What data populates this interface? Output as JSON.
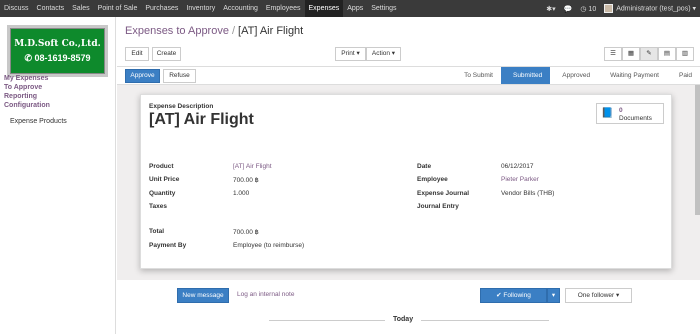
{
  "topbar": {
    "menu": [
      "Discuss",
      "Contacts",
      "Sales",
      "Point of Sale",
      "Purchases",
      "Inventory",
      "Accounting",
      "Employees",
      "Expenses",
      "Apps",
      "Settings"
    ],
    "active": "Expenses",
    "notif_count": "10",
    "user": "Administrator (test_pos)"
  },
  "logo": {
    "company": "M.D.Soft Co.,Ltd.",
    "phone": "08-1619-8579"
  },
  "sidebar": {
    "items": [
      "My Expenses",
      "To Approve",
      "Reporting",
      "Configuration"
    ],
    "sub": "Expense Products"
  },
  "breadcrumb": {
    "parent": "Expenses to Approve",
    "current": "[AT] Air Flight"
  },
  "buttons": {
    "edit": "Edit",
    "create": "Create",
    "print": "Print",
    "action": "Action",
    "approve": "Approve",
    "refuse": "Refuse"
  },
  "steps": [
    "To Submit",
    "Submitted",
    "Approved",
    "Waiting Payment",
    "Paid"
  ],
  "current_step": "Submitted",
  "form": {
    "desc_label": "Expense Description",
    "title": "[AT] Air Flight",
    "docs_count": "0",
    "docs_label": "Documents",
    "product_label": "Product",
    "product": "[AT] Air Flight",
    "unit_price_label": "Unit Price",
    "unit_price": "700.00 ฿",
    "quantity_label": "Quantity",
    "quantity": "1.000",
    "taxes_label": "Taxes",
    "date_label": "Date",
    "date": "06/12/2017",
    "employee_label": "Employee",
    "employee": "Pieter Parker",
    "journal_label": "Expense Journal",
    "journal": "Vendor Bills (THB)",
    "journal_entry_label": "Journal Entry",
    "total_label": "Total",
    "total": "700.00 ฿",
    "payby_label": "Payment By",
    "payby": "Employee (to reimburse)"
  },
  "chatter": {
    "new_message": "New message",
    "log_note": "Log an internal note",
    "following": "Following",
    "followers": "One follower",
    "today": "Today"
  }
}
